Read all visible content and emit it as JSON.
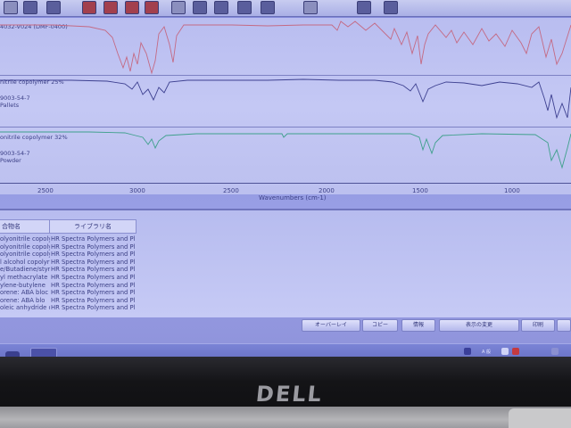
{
  "spectra": [
    {
      "label_1": "4032-V024 (DMF-0400)",
      "label_2": "",
      "label_3": "",
      "color": "#c06a80"
    },
    {
      "label_1": "nitrile copolymer 25%",
      "label_2": "9003-54-7",
      "label_3": "Pallets",
      "color": "#3c3f8a"
    },
    {
      "label_1": "onitrile copolymer 32%",
      "label_2": "9003-54-7",
      "label_3": "Powder",
      "color": "#3f9a8a"
    }
  ],
  "axis": {
    "title": "Wavenumbers (cm-1)",
    "ticks": [
      "2500",
      "3000",
      "2500",
      "2000",
      "1500",
      "1000"
    ]
  },
  "results": {
    "headers": {
      "compound": "合物名",
      "library": "ライブラリ名"
    },
    "rows": [
      {
        "compound": "olyonitrile copoly",
        "library": "HR Spectra Polymers and Pl"
      },
      {
        "compound": "olyonitrile copoly",
        "library": "HR Spectra Polymers and Pl"
      },
      {
        "compound": "olyonitrile copoly",
        "library": "HR Spectra Polymers and Pl"
      },
      {
        "compound": "l alcohol copolyr",
        "library": "HR Spectra Polymers and Pl"
      },
      {
        "compound": "e/Butadiene/styr",
        "library": "HR Spectra Polymers and Pl"
      },
      {
        "compound": "yl methacrylate",
        "library": "HR Spectra Polymers and Pl"
      },
      {
        "compound": "ylene-butylene",
        "library": "HR Spectra Polymers and Pl"
      },
      {
        "compound": "orene: ABA bloc",
        "library": "HR Spectra Polymers and Pl"
      },
      {
        "compound": "orene: ABA blo",
        "library": "HR Spectra Polymers and Pl"
      },
      {
        "compound": "oleic anhydride c",
        "library": "HR Spectra Polymers and Pl"
      }
    ]
  },
  "buttons": {
    "overlay": "オーバーレイ",
    "copy": "コピー",
    "info": "情報",
    "display_change": "表示の変更",
    "print": "印刷"
  },
  "taskbar": {
    "tray_ime": "A 般",
    "clock": ""
  },
  "brand": "DELL",
  "colors": {
    "screen_bg": "#8f95e0",
    "spectrum_bg": "#c4c8f4"
  }
}
